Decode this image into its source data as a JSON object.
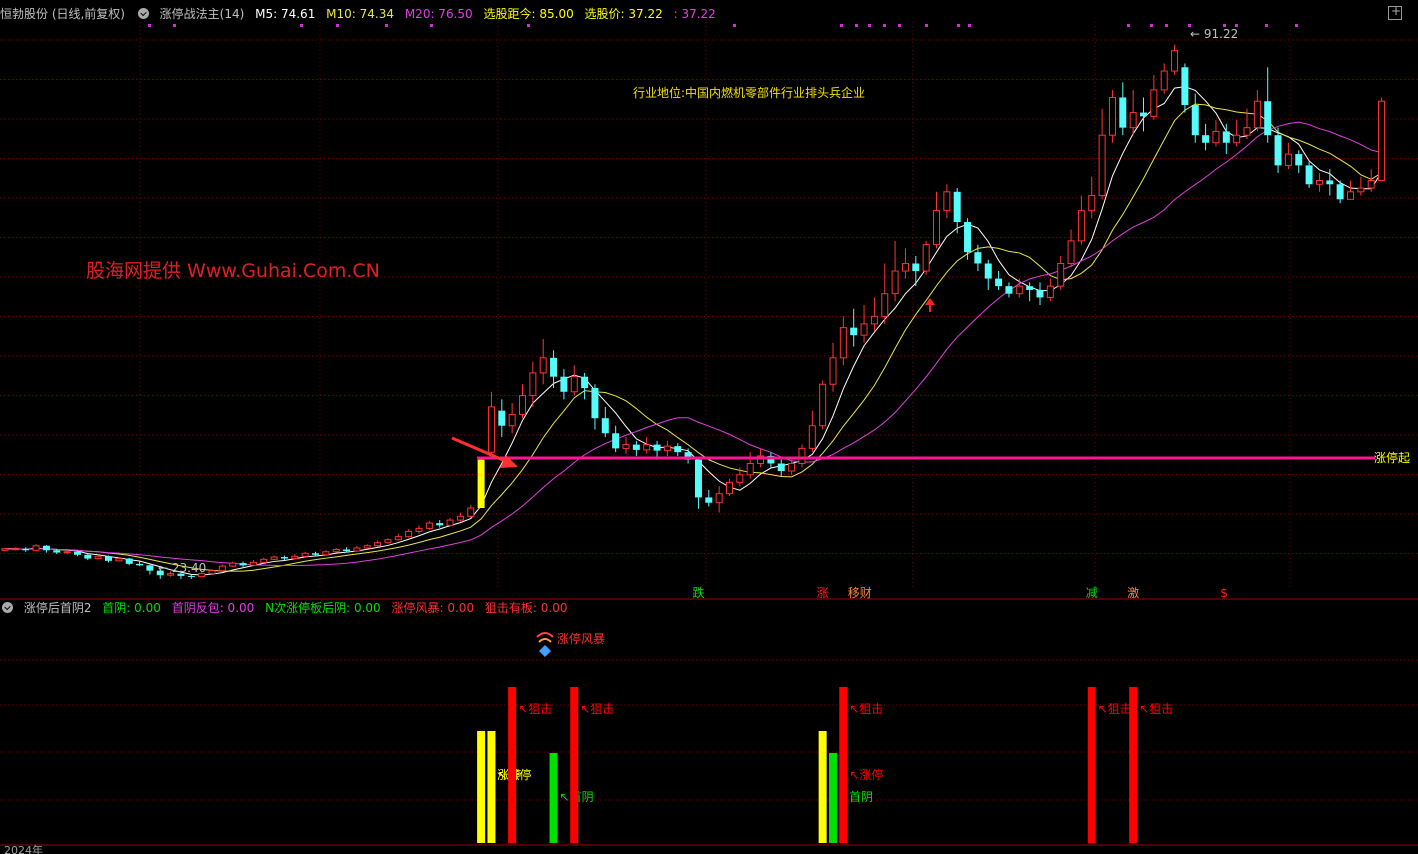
{
  "header": {
    "stock": "恒勃股份 (日线,前复权)",
    "indicator": "涨停战法主(14)",
    "ma5": "M5: 74.61",
    "ma10": "M10: 74.34",
    "ma20": "M20: 76.50",
    "select_dist": "选股距今: 85.00",
    "select_price": "选股价: 37.22",
    "last": ": 37.22"
  },
  "sub_header": {
    "name": "涨停后首阴2",
    "first_yin": "首阴: 0.00",
    "first_yin_reverse": "首阴反包: 0.00",
    "n_limit_yin": "N次涨停板后阴: 0.00",
    "storm": "涨停风暴: 0.00",
    "snipe_board": "狙击有板: 0.00"
  },
  "annotations": {
    "watermark": "股海网提供 Www.Guhai.Com.CN",
    "industry": "行业地位:中国内燃机零部件行业排头兵企业",
    "limit_up_line": "涨停起",
    "high_label": "91.22",
    "low_label": "23.40",
    "storm_label": "涨停风暴",
    "year_label": "2024年"
  },
  "colors": {
    "up": "#ff3232",
    "down": "#54fcfc",
    "ma5": "#ffffff",
    "ma10": "#e6e64c",
    "ma20": "#e040e0",
    "limit_line": "#ff1493",
    "yellow": "#ffff00",
    "green": "#00e000",
    "red": "#ff0000",
    "header_gray": "#c0c0c0"
  },
  "chart_data": [
    {
      "type": "candlestick",
      "title": "涨停战法主(14)",
      "ylim": [
        20,
        95
      ],
      "reference_line": {
        "label": "涨停起",
        "y": 37.22
      },
      "markers": [
        {
          "label": "跌",
          "i": 67,
          "color": "#00e000"
        },
        {
          "label": "涨",
          "i": 79,
          "color": "#ff2020"
        },
        {
          "label": "移财",
          "i": 82,
          "color": "#ff8040"
        },
        {
          "label": "减",
          "i": 105,
          "color": "#00e000"
        },
        {
          "label": "激",
          "i": 109,
          "color": "#ff8040"
        },
        {
          "label": "$",
          "i": 118,
          "color": "#ff2020"
        }
      ],
      "candles": [
        [
          25.0,
          25.2,
          25.3,
          24.9
        ],
        [
          25.2,
          25.2,
          25.4,
          25.0
        ],
        [
          25.2,
          25.0,
          25.4,
          24.8
        ],
        [
          25.0,
          25.6,
          25.8,
          24.9
        ],
        [
          25.6,
          25.0,
          25.7,
          24.7
        ],
        [
          25.0,
          24.7,
          25.2,
          24.5
        ],
        [
          24.7,
          24.8,
          25.0,
          24.5
        ],
        [
          24.8,
          24.4,
          25.0,
          24.2
        ],
        [
          24.4,
          23.9,
          24.6,
          23.7
        ],
        [
          23.9,
          24.2,
          24.4,
          23.8
        ],
        [
          24.2,
          23.6,
          24.3,
          23.4
        ],
        [
          23.6,
          23.9,
          24.1,
          23.5
        ],
        [
          23.9,
          23.2,
          24.0,
          23.0
        ],
        [
          23.2,
          23.0,
          23.5,
          22.9
        ],
        [
          23.0,
          22.3,
          23.1,
          21.8
        ],
        [
          22.3,
          21.7,
          22.5,
          21.2
        ],
        [
          21.7,
          21.9,
          22.2,
          21.5
        ],
        [
          21.9,
          21.6,
          22.0,
          21.2
        ],
        [
          21.6,
          21.5,
          21.8,
          21.2
        ],
        [
          21.5,
          21.9,
          22.1,
          21.4
        ],
        [
          21.9,
          22.3,
          22.5,
          21.8
        ],
        [
          22.3,
          22.9,
          23.1,
          22.2
        ],
        [
          22.9,
          23.3,
          23.5,
          22.8
        ],
        [
          23.3,
          23.0,
          23.5,
          22.8
        ],
        [
          23.0,
          23.4,
          23.7,
          22.9
        ],
        [
          23.4,
          23.8,
          24.0,
          23.3
        ],
        [
          23.8,
          24.1,
          24.3,
          23.7
        ],
        [
          24.1,
          23.9,
          24.3,
          23.7
        ],
        [
          23.9,
          24.2,
          24.5,
          23.8
        ],
        [
          24.2,
          24.6,
          24.8,
          24.1
        ],
        [
          24.6,
          24.4,
          24.8,
          24.2
        ],
        [
          24.4,
          24.8,
          25.0,
          24.3
        ],
        [
          24.8,
          25.1,
          25.3,
          24.7
        ],
        [
          25.1,
          24.9,
          25.4,
          24.7
        ],
        [
          24.9,
          25.3,
          25.6,
          24.8
        ],
        [
          25.3,
          25.6,
          25.8,
          25.2
        ],
        [
          25.6,
          26.0,
          26.3,
          25.5
        ],
        [
          26.0,
          26.4,
          26.6,
          25.9
        ],
        [
          26.4,
          26.8,
          27.2,
          26.3
        ],
        [
          26.8,
          27.5,
          27.8,
          26.7
        ],
        [
          27.5,
          27.9,
          28.3,
          27.2
        ],
        [
          27.9,
          28.6,
          28.9,
          27.7
        ],
        [
          28.6,
          28.3,
          29.0,
          28.0
        ],
        [
          28.3,
          29.0,
          29.3,
          28.1
        ],
        [
          29.0,
          29.5,
          30.0,
          28.8
        ],
        [
          29.5,
          30.6,
          31.0,
          29.3
        ],
        [
          30.6,
          37.0,
          37.2,
          30.6
        ],
        [
          38.0,
          44.0,
          46.0,
          37.5
        ],
        [
          43.5,
          41.5,
          45.0,
          40.0
        ],
        [
          41.5,
          43.0,
          44.5,
          40.5
        ],
        [
          43.0,
          45.5,
          47.0,
          42.5
        ],
        [
          45.5,
          48.5,
          50.0,
          44.0
        ],
        [
          48.5,
          50.5,
          53.0,
          47.0
        ],
        [
          50.5,
          48.0,
          51.5,
          46.5
        ],
        [
          48.0,
          46.0,
          49.0,
          45.0
        ],
        [
          46.0,
          48.0,
          49.5,
          45.5
        ],
        [
          48.0,
          46.5,
          48.5,
          45.0
        ],
        [
          46.5,
          42.5,
          47.0,
          41.0
        ],
        [
          42.5,
          40.5,
          44.0,
          40.0
        ],
        [
          40.5,
          38.5,
          41.5,
          38.0
        ],
        [
          38.5,
          39.0,
          40.0,
          37.8
        ],
        [
          39.0,
          38.3,
          39.5,
          37.5
        ],
        [
          38.3,
          39.0,
          40.0,
          37.8
        ],
        [
          39.0,
          38.2,
          39.5,
          37.0
        ],
        [
          38.2,
          38.8,
          39.5,
          37.5
        ],
        [
          38.8,
          38.0,
          39.2,
          37.5
        ],
        [
          38.0,
          37.0,
          38.5,
          36.5
        ],
        [
          37.0,
          32.0,
          37.2,
          30.5
        ],
        [
          32.0,
          31.3,
          33.0,
          30.8
        ],
        [
          31.3,
          32.5,
          33.5,
          30.0
        ],
        [
          32.5,
          34.0,
          34.5,
          32.2
        ],
        [
          34.0,
          35.0,
          36.0,
          33.5
        ],
        [
          35.0,
          36.5,
          38.0,
          34.5
        ],
        [
          36.5,
          37.5,
          38.5,
          36.0
        ],
        [
          37.5,
          36.5,
          38.0,
          36.0
        ],
        [
          36.5,
          35.5,
          37.0,
          34.8
        ],
        [
          35.5,
          36.5,
          37.0,
          35.0
        ],
        [
          36.5,
          38.5,
          39.0,
          36.0
        ],
        [
          38.5,
          41.5,
          43.5,
          38.0
        ],
        [
          41.5,
          47.0,
          47.5,
          41.0
        ],
        [
          47.0,
          50.5,
          52.5,
          46.0
        ],
        [
          50.5,
          54.5,
          56.0,
          49.5
        ],
        [
          54.5,
          53.5,
          57.0,
          52.0
        ],
        [
          53.5,
          55.0,
          57.5,
          52.5
        ],
        [
          55.0,
          56.0,
          58.5,
          54.0
        ],
        [
          56.0,
          59.0,
          63.0,
          55.0
        ],
        [
          59.0,
          62.0,
          66.0,
          58.0
        ],
        [
          62.0,
          63.0,
          65.0,
          61.0
        ],
        [
          63.0,
          62.0,
          64.0,
          60.0
        ],
        [
          62.0,
          65.5,
          66.0,
          61.5
        ],
        [
          65.5,
          70.0,
          72.5,
          65.0
        ],
        [
          70.0,
          72.5,
          73.5,
          69.0
        ],
        [
          72.5,
          68.5,
          73.0,
          67.0
        ],
        [
          68.5,
          64.5,
          69.0,
          63.5
        ],
        [
          64.5,
          63.0,
          65.5,
          62.0
        ],
        [
          63.0,
          61.0,
          63.5,
          59.5
        ],
        [
          61.0,
          60.0,
          62.0,
          59.5
        ],
        [
          60.0,
          59.0,
          60.5,
          58.5
        ],
        [
          59.0,
          60.0,
          61.0,
          58.5
        ],
        [
          60.0,
          59.5,
          60.5,
          58.0
        ],
        [
          59.5,
          58.5,
          60.5,
          57.5
        ],
        [
          58.5,
          60.0,
          61.0,
          58.0
        ],
        [
          60.0,
          63.0,
          64.0,
          59.5
        ],
        [
          63.0,
          66.0,
          67.5,
          62.5
        ],
        [
          66.0,
          70.0,
          72.0,
          65.5
        ],
        [
          70.0,
          72.0,
          74.5,
          69.0
        ],
        [
          72.0,
          80.0,
          83.5,
          71.5
        ],
        [
          80.0,
          85.0,
          86.0,
          79.0
        ],
        [
          85.0,
          81.0,
          87.0,
          80.0
        ],
        [
          81.0,
          83.0,
          86.0,
          80.0
        ],
        [
          83.0,
          82.5,
          85.0,
          80.5
        ],
        [
          82.5,
          86.0,
          88.0,
          82.0
        ],
        [
          86.0,
          88.5,
          89.5,
          85.5
        ],
        [
          88.5,
          91.2,
          92.0,
          88.0
        ],
        [
          89.0,
          84.0,
          89.5,
          83.0
        ],
        [
          84.0,
          80.0,
          85.5,
          79.0
        ],
        [
          80.0,
          79.0,
          81.5,
          78.0
        ],
        [
          79.0,
          80.5,
          82.0,
          78.5
        ],
        [
          80.5,
          79.0,
          81.5,
          77.5
        ],
        [
          79.0,
          80.0,
          82.0,
          78.5
        ],
        [
          80.0,
          81.0,
          83.5,
          79.5
        ],
        [
          81.0,
          84.5,
          86.0,
          80.5
        ],
        [
          84.5,
          80.0,
          89.0,
          79.0
        ],
        [
          80.0,
          76.0,
          81.0,
          75.0
        ],
        [
          76.0,
          77.5,
          79.0,
          75.5
        ],
        [
          77.5,
          76.0,
          78.0,
          75.0
        ],
        [
          76.0,
          73.5,
          76.5,
          73.0
        ],
        [
          73.5,
          74.0,
          75.0,
          72.5
        ],
        [
          74.0,
          73.5,
          75.5,
          72.0
        ],
        [
          73.5,
          71.5,
          74.0,
          71.0
        ],
        [
          71.5,
          72.5,
          74.0,
          71.5
        ],
        [
          72.5,
          73.0,
          74.5,
          72.0
        ],
        [
          73.0,
          74.0,
          75.5,
          72.5
        ],
        [
          74.0,
          84.5,
          85.0,
          74.0
        ]
      ]
    },
    {
      "type": "bar",
      "title": "涨停后首阴2",
      "bars": [
        {
          "i": 46,
          "kind": "yellow",
          "label": "涨停"
        },
        {
          "i": 47,
          "kind": "yellow",
          "label": "涨停"
        },
        {
          "i": 49,
          "kind": "red",
          "label": "狙击"
        },
        {
          "i": 53,
          "kind": "green",
          "label": "首阴"
        },
        {
          "i": 55,
          "kind": "red",
          "label": "狙击"
        },
        {
          "i": 79,
          "kind": "yellow",
          "label": ""
        },
        {
          "i": 80,
          "kind": "green",
          "label": "首阴"
        },
        {
          "i": 81,
          "kind": "red",
          "label": "狙击"
        },
        {
          "i": 81,
          "kind": "red",
          "label": "涨停"
        },
        {
          "i": 105,
          "kind": "red",
          "label": "狙击"
        },
        {
          "i": 109,
          "kind": "red",
          "label": "狙击"
        }
      ]
    }
  ]
}
